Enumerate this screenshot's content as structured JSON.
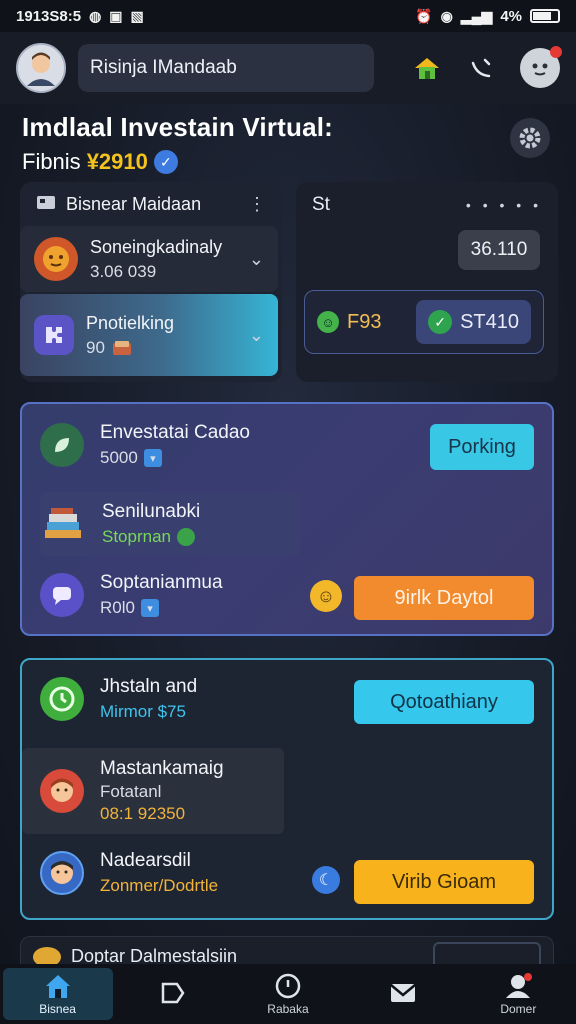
{
  "status_bar": {
    "time": "1913S8:5",
    "battery": "4%"
  },
  "app_bar": {
    "title": "Risinja IMandaab",
    "icons": [
      "home-icon",
      "phone-icon",
      "robot-icon"
    ]
  },
  "page": {
    "title": "Imdlaal Investain Virtual:",
    "sub_label": "Fibnis",
    "sub_value": "¥2910"
  },
  "top_left": {
    "header": "Bisnear Maidaan",
    "row1": {
      "title": "Soneingkadinaly",
      "value": "3.06 039"
    },
    "row2": {
      "title": "Pnotielking",
      "value": "90"
    }
  },
  "top_right": {
    "header": "St",
    "value": "36.110",
    "stat_a": "F93",
    "stat_b": "ST410"
  },
  "invest": {
    "row1": {
      "title": "Envestatai Cadao",
      "value": "5000"
    },
    "row2": {
      "title": "Senilunabki",
      "value": "Stoprnan"
    },
    "row3": {
      "title": "Soptanianmua",
      "value": "R0l0"
    },
    "btn1": "Porking",
    "btn2": "9irlk Daytol"
  },
  "stats": {
    "row1": {
      "title": "Jhstaln and",
      "value": "Mirmor $75"
    },
    "row2": {
      "title": "Mastankamaig",
      "sub": "Fotatanl",
      "value": "08:1 92350"
    },
    "row3": {
      "title": "Nadearsdil",
      "value": "Zonmer/Dodrtle"
    },
    "btn1": "Qotoathiany",
    "btn2": "Virib Gioam"
  },
  "peek": {
    "title": "Doptar Dalmestalsiin"
  },
  "nav": {
    "items": [
      {
        "label": "Bisnea"
      },
      {
        "label": ""
      },
      {
        "label": "Rabaka"
      },
      {
        "label": ""
      },
      {
        "label": "Domer"
      }
    ]
  },
  "colors": {
    "accent_cyan": "#39c7e6",
    "accent_orange": "#f28a2e",
    "accent_yellow": "#f7b21c",
    "card_border_blue": "#5772c4",
    "card_border_cyan": "#3ea7c8"
  }
}
